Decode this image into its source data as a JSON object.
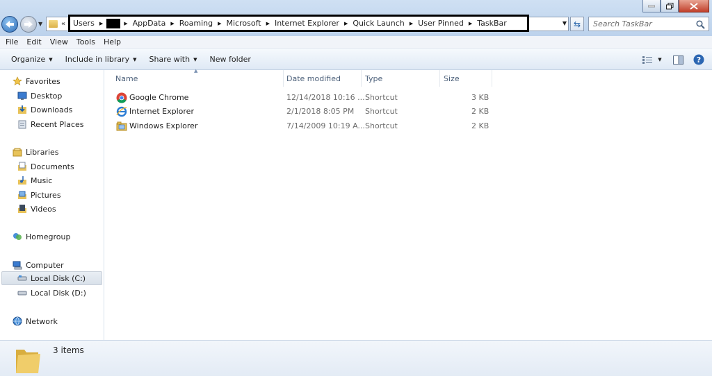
{
  "search": {
    "placeholder": "Search TaskBar"
  },
  "breadcrumbs": [
    "Users",
    "AppData",
    "Roaming",
    "Microsoft",
    "Internet Explorer",
    "Quick Launch",
    "User Pinned",
    "TaskBar"
  ],
  "menu": [
    "File",
    "Edit",
    "View",
    "Tools",
    "Help"
  ],
  "toolbar": {
    "organize": "Organize",
    "include": "Include in library",
    "share": "Share with",
    "new_folder": "New folder"
  },
  "nav": {
    "favorites": "Favorites",
    "desktop": "Desktop",
    "downloads": "Downloads",
    "recent": "Recent Places",
    "libraries": "Libraries",
    "documents": "Documents",
    "music": "Music",
    "pictures": "Pictures",
    "videos": "Videos",
    "homegroup": "Homegroup",
    "computer": "Computer",
    "disk_c": "Local Disk (C:)",
    "disk_d": "Local Disk (D:)",
    "network": "Network"
  },
  "columns": {
    "name": "Name",
    "date": "Date modified",
    "type": "Type",
    "size": "Size"
  },
  "files": [
    {
      "name": "Google Chrome",
      "date": "12/14/2018 10:16 ...",
      "type": "Shortcut",
      "size": "3 KB",
      "icon": "chrome-icon"
    },
    {
      "name": "Internet Explorer",
      "date": "2/1/2018 8:05 PM",
      "type": "Shortcut",
      "size": "2 KB",
      "icon": "internet-explorer-icon"
    },
    {
      "name": "Windows Explorer",
      "date": "7/14/2009 10:19 A...",
      "type": "Shortcut",
      "size": "2 KB",
      "icon": "windows-explorer-icon"
    }
  ],
  "status": {
    "count": "3 items"
  },
  "colors": {
    "accent": "#1f5fa8",
    "folder": "#e8c35a",
    "chrome_red": "#db4437",
    "chrome_green": "#0f9d58",
    "chrome_yellow": "#f4b400"
  }
}
